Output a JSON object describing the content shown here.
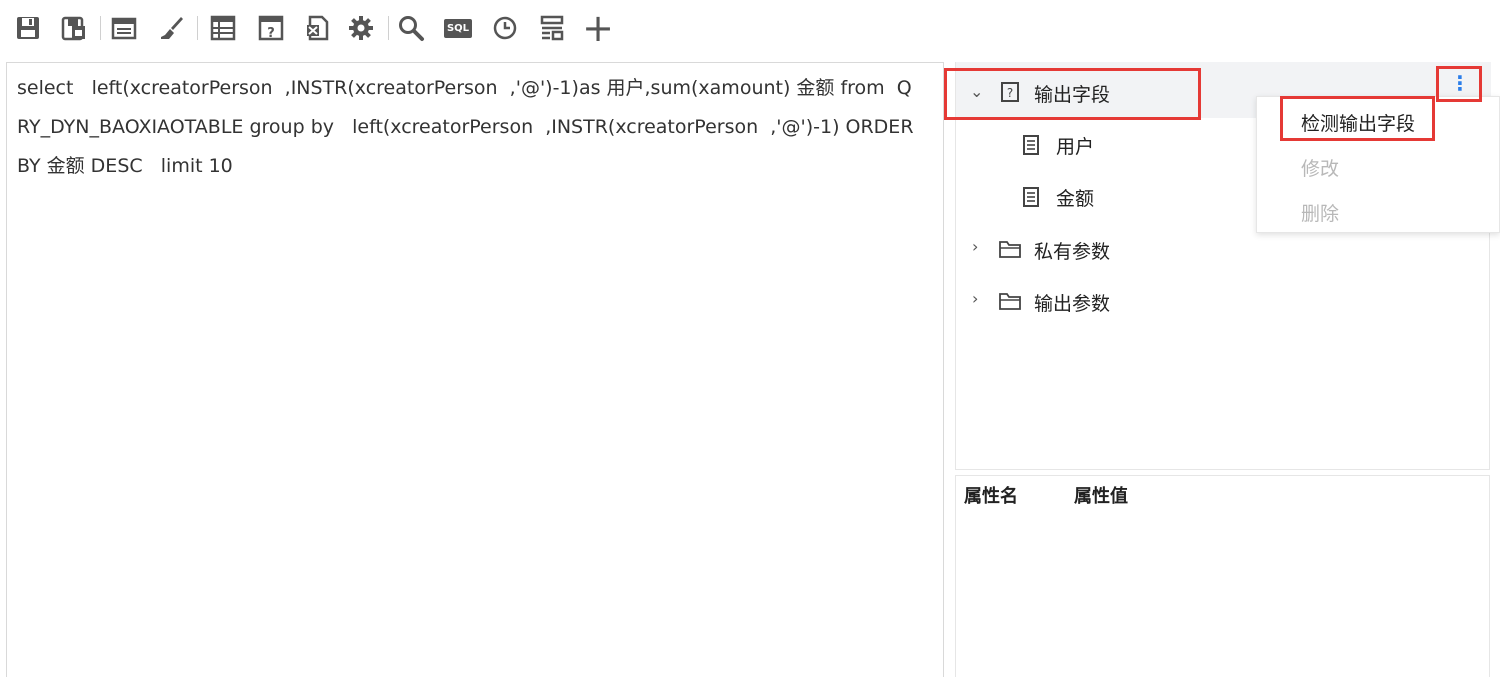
{
  "toolbar": {
    "icons": [
      "save-icon",
      "save-as-icon",
      "window-icon",
      "brush-icon",
      "table-icon",
      "help-table-icon",
      "excel-icon",
      "settings-icon",
      "search-icon",
      "sql-icon",
      "clock-icon",
      "filter-icon",
      "add-icon"
    ],
    "sql_badge": "SQL",
    "add_glyph": "+"
  },
  "editor": {
    "sql": "select   left(xcreatorPerson  ,INSTR(xcreatorPerson  ,'@')-1)as 用户,sum(xamount) 金额 from  QRY_DYN_BAOXIAOTABLE group by   left(xcreatorPerson  ,INSTR(xcreatorPerson  ,'@')-1) ORDER BY 金额 DESC   limit 10"
  },
  "tree": {
    "output_fields": {
      "label": "输出字段",
      "children": [
        {
          "label": "用户"
        },
        {
          "label": "金额"
        }
      ]
    },
    "private_params": {
      "label": "私有参数"
    },
    "output_params": {
      "label": "输出参数"
    },
    "more_glyph": "⋮"
  },
  "context_menu": {
    "items": [
      {
        "label": "检测输出字段",
        "enabled": true
      },
      {
        "label": "修改",
        "enabled": false
      },
      {
        "label": "删除",
        "enabled": false
      }
    ]
  },
  "properties": {
    "col_name": "属性名",
    "col_value": "属性值"
  },
  "colors": {
    "highlight": "#e53935",
    "accent": "#2b7de9",
    "disabled": "#b8b8b8"
  }
}
